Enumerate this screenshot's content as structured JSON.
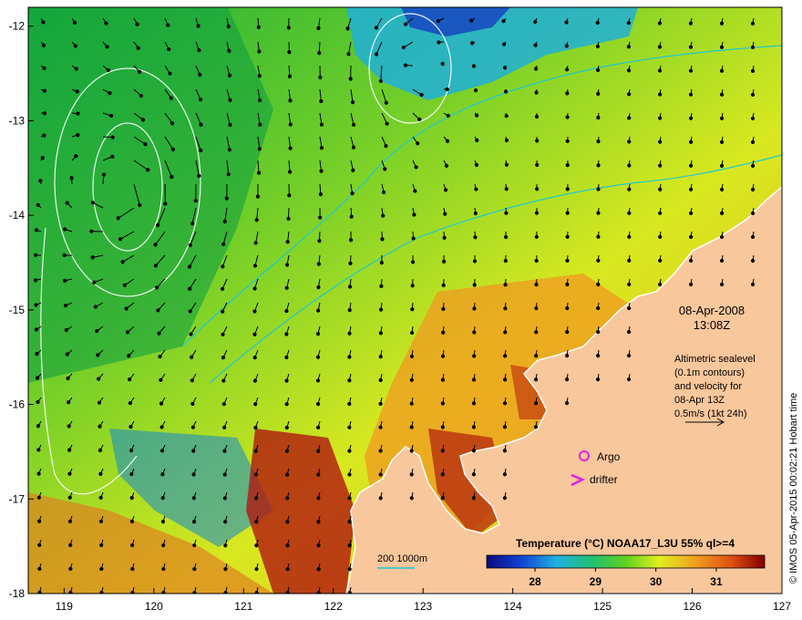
{
  "map": {
    "lon_range": [
      118.6,
      127
    ],
    "lat_range": [
      -18,
      -11.8
    ],
    "x_ticks": [
      "119",
      "120",
      "121",
      "122",
      "123",
      "124",
      "125",
      "126",
      "127"
    ],
    "y_ticks": [
      "-12",
      "-13",
      "-14",
      "-15",
      "-16",
      "-17",
      "-18"
    ]
  },
  "annotations": {
    "date": "08-Apr-2008",
    "time": "13:08Z",
    "legend_lines": [
      "Altimetric sealevel",
      "(0.1m contours)",
      "and velocity for",
      "08-Apr 13Z",
      "0.5m/s (1kt 24h)"
    ],
    "argo_label": "Argo",
    "drifter_label": "drifter",
    "depth_label": "200  1000m"
  },
  "colorbar": {
    "title": "Temperature (°C) NOAA17_L3U 55% ql>=4",
    "range": [
      27.2,
      31.8
    ],
    "ticks": [
      "28",
      "29",
      "30",
      "31"
    ]
  },
  "credit": "© IMOS 05-Apr-2015 00:02:21 Hobart time",
  "colors": {
    "land": "#f9c79c",
    "argo": "#e020e0",
    "drifter": "#e020e0",
    "depth_contour": "#20c8d0",
    "sealevel_contour": "#ffffff"
  }
}
